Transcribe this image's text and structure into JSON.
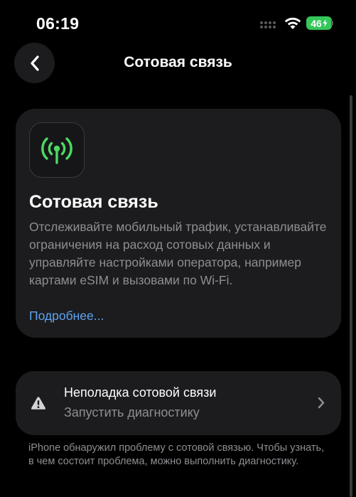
{
  "status_bar": {
    "time": "06:19",
    "battery_label": "46",
    "battery_color": "#34c759"
  },
  "nav": {
    "title": "Сотовая связь",
    "back_icon": "chevron-left-icon"
  },
  "info_card": {
    "icon": "cellular-antenna-icon",
    "icon_color": "#4cd964",
    "title": "Сотовая связь",
    "description": "Отслеживайте мобильный трафик, устанавливайте ограничения на расход сотовых данных и управляйте настройками оператора, например картами eSIM и вызовами по Wi-Fi.",
    "more_link": "Подробнее..."
  },
  "diagnostics": {
    "icon": "warning-icon",
    "title": "Неполадка сотовой связи",
    "subtitle": "Запустить диагностику",
    "chevron": "chevron-right-icon"
  },
  "footnote": "iPhone обнаружил проблему с сотовой связью. Чтобы узнать, в чем состоит проблема, можно выполнить диагностику.",
  "colors": {
    "background": "#000000",
    "card": "#1c1c1e",
    "secondary_text": "#8e8e93",
    "link": "#5ea3f2"
  }
}
